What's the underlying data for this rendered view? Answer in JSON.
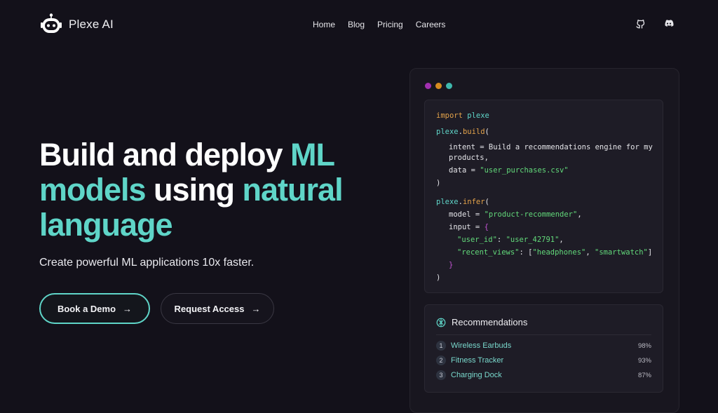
{
  "header": {
    "brand": "Plexe AI",
    "nav": [
      "Home",
      "Blog",
      "Pricing",
      "Careers"
    ],
    "social_icons": [
      "github-icon",
      "discord-icon"
    ]
  },
  "hero": {
    "title_parts": [
      {
        "text": "Build and deploy ",
        "accent": false
      },
      {
        "text": "ML models",
        "accent": true
      },
      {
        "text": " using ",
        "accent": false
      },
      {
        "text": "natural language",
        "accent": true
      }
    ],
    "subtitle": "Create powerful ML applications 10x faster.",
    "primary_button": "Book a Demo",
    "secondary_button": "Request Access"
  },
  "code_window": {
    "dot_colors": [
      "#a12fb0",
      "#d68b1f",
      "#3fb8ad"
    ],
    "lines": [
      "import plexe",
      "plexe.build(",
      "intent = \"Build a recommendations engine for my",
      "products\",",
      "data = \"user_purchases.csv\"",
      ")",
      "plexe.infer(",
      "model = \"product-recommender\",",
      "input = {",
      "\"user_id\": \"user_42791\",",
      "\"recent_views\": [\"headphones\", \"smartwatch\"]",
      "}",
      ")"
    ]
  },
  "recommendations": {
    "title": "Recommendations",
    "items": [
      {
        "rank": "1",
        "name": "Wireless Earbuds",
        "score": "98%"
      },
      {
        "rank": "2",
        "name": "Fitness Tracker",
        "score": "93%"
      },
      {
        "rank": "3",
        "name": "Charging Dock",
        "score": "87%"
      }
    ]
  },
  "colors": {
    "accent": "#5fd5c8",
    "background": "#13111a"
  }
}
